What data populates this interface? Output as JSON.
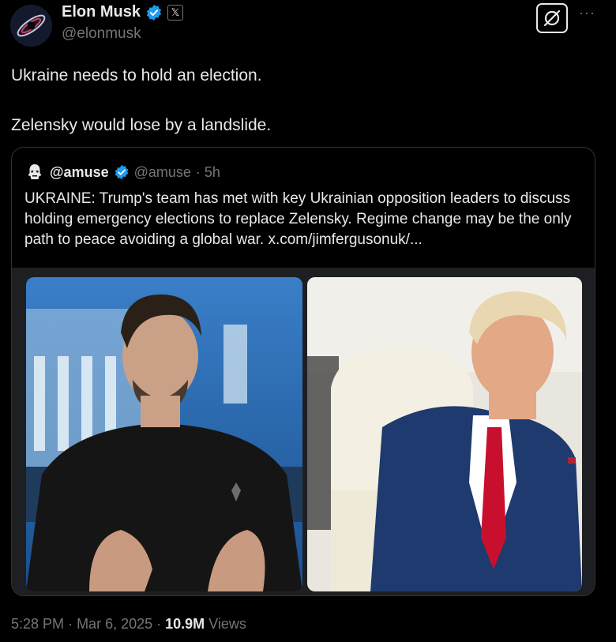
{
  "author": {
    "name": "Elon Musk",
    "handle": "@elonmusk",
    "x_badge": "𝕏",
    "avatar_icon": "galaxy-avatar"
  },
  "menu": {
    "more": "···",
    "grok_icon": "grok-icon"
  },
  "tweet": {
    "lines": [
      "Ukraine needs to hold an election.",
      "Zelensky would lose by a landslide."
    ]
  },
  "quote": {
    "name": "@amuse",
    "handle": "@amuse",
    "time": "· 5h",
    "text": "UKRAINE: Trump's team has met with key Ukrainian opposition leaders to discuss holding emergency elections to replace Zelensky. Regime change may be the only path to peace avoiding a global war.  x.com/jimfergusonuk/...",
    "images": [
      "photo-zelensky",
      "photo-trump"
    ]
  },
  "meta": {
    "time": "5:28 PM",
    "date": "Mar 6, 2025",
    "views_count": "10.9M",
    "views_label": "Views"
  },
  "colors": {
    "background": "#000000",
    "text": "#e7e9ea",
    "muted": "#71767b",
    "verified": "#1d9bf0",
    "border": "#2f3336"
  }
}
